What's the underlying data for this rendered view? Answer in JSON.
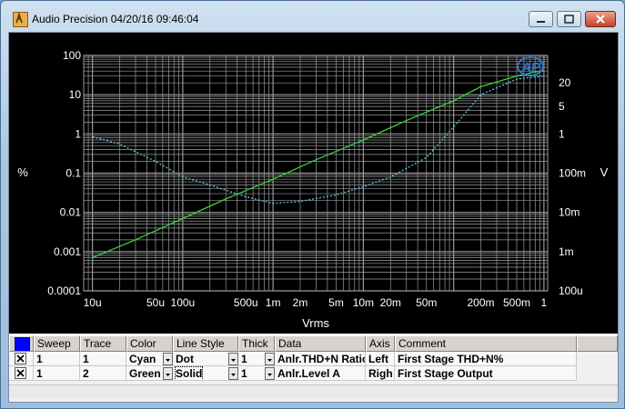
{
  "window": {
    "title": "Audio Precision  04/20/16 09:46:04"
  },
  "colors": {
    "plot_background": "#000000",
    "grid": "#9a9a9a",
    "trace_1": "#57c7e6",
    "trace_2": "#39d139",
    "selected_color_swatch": "#0000ff"
  },
  "icons": [
    "app-logo-icon",
    "minimize-icon",
    "maximize-icon",
    "close-icon",
    "checkbox-checked-icon",
    "dropdown-arrow-icon",
    "ap-logo-icon"
  ],
  "chart_data": {
    "type": "line",
    "xlabel": "Vrms",
    "ylabel_left": "%",
    "ylabel_right": "V",
    "x_scale": "log",
    "y_scale_left": "log",
    "y_scale_right": "log",
    "xlim": [
      8e-06,
      1.1
    ],
    "ylim_left": [
      0.0001,
      100
    ],
    "ylim_right": [
      0.1,
      20
    ],
    "grid": true,
    "x_tick_labels": [
      {
        "v": 1e-05,
        "t": "10u"
      },
      {
        "v": 5e-05,
        "t": "50u"
      },
      {
        "v": 0.0001,
        "t": "100u"
      },
      {
        "v": 0.0005,
        "t": "500u"
      },
      {
        "v": 0.001,
        "t": "1m"
      },
      {
        "v": 0.002,
        "t": "2m"
      },
      {
        "v": 0.005,
        "t": "5m"
      },
      {
        "v": 0.01,
        "t": "10m"
      },
      {
        "v": 0.02,
        "t": "20m"
      },
      {
        "v": 0.05,
        "t": "50m"
      },
      {
        "v": 0.2,
        "t": "200m"
      },
      {
        "v": 0.5,
        "t": "500m"
      },
      {
        "v": 1,
        "t": "1"
      }
    ],
    "y_left_tick_labels": [
      {
        "v": 100,
        "t": "100"
      },
      {
        "v": 10,
        "t": "10"
      },
      {
        "v": 1,
        "t": "1"
      },
      {
        "v": 0.1,
        "t": "0.1"
      },
      {
        "v": 0.01,
        "t": "0.01"
      },
      {
        "v": 0.001,
        "t": "0.001"
      },
      {
        "v": 0.0001,
        "t": "0.0001"
      }
    ],
    "y_right_tick_labels": [
      {
        "v": 20,
        "t": "20"
      },
      {
        "v": 5,
        "t": "5"
      },
      {
        "v": 1,
        "t": "1"
      },
      {
        "v": 0.1,
        "t": "100m"
      },
      {
        "v": 0.01,
        "t": "10m"
      },
      {
        "v": 0.001,
        "t": "1m"
      },
      {
        "v": 0.0001,
        "t": "100u"
      }
    ],
    "series": [
      {
        "name": "Anlr.THD+N Ratio",
        "axis": "left",
        "color": "cyan",
        "style": "dot",
        "x": [
          1e-05,
          2e-05,
          5e-05,
          0.0001,
          0.0002,
          0.0005,
          0.001,
          0.002,
          0.005,
          0.01,
          0.02,
          0.05,
          0.1,
          0.2,
          0.5,
          1
        ],
        "y": [
          0.85,
          0.55,
          0.2,
          0.08,
          0.05,
          0.025,
          0.017,
          0.019,
          0.028,
          0.045,
          0.08,
          0.25,
          1.5,
          10,
          25,
          30
        ]
      },
      {
        "name": "Anlr.Level A",
        "axis": "left",
        "color": "green",
        "style": "solid",
        "x": [
          1e-05,
          3e-05,
          0.0001,
          0.0003,
          0.001,
          0.003,
          0.01,
          0.03,
          0.1,
          0.2,
          0.5,
          0.8,
          1
        ],
        "y": [
          0.0007,
          0.002,
          0.007,
          0.022,
          0.07,
          0.22,
          0.7,
          2.2,
          7,
          16,
          30,
          38,
          40
        ]
      }
    ]
  },
  "table": {
    "headers": {
      "sweep": "Sweep",
      "trace": "Trace",
      "color": "Color",
      "line_style": "Line Style",
      "thick": "Thick",
      "data": "Data",
      "axis": "Axis",
      "comment": "Comment"
    },
    "rows": [
      {
        "checked": true,
        "sweep": "1",
        "trace": "1",
        "color": "Cyan",
        "line_style": "Dot",
        "thick": "1",
        "data": "Anlr.THD+N Ratio",
        "axis": "Left",
        "comment": "First Stage THD+N%"
      },
      {
        "checked": true,
        "sweep": "1",
        "trace": "2",
        "color": "Green",
        "line_style": "Solid",
        "thick": "1",
        "data": "Anlr.Level A",
        "axis": "Righ",
        "comment": "First Stage Output"
      }
    ]
  }
}
